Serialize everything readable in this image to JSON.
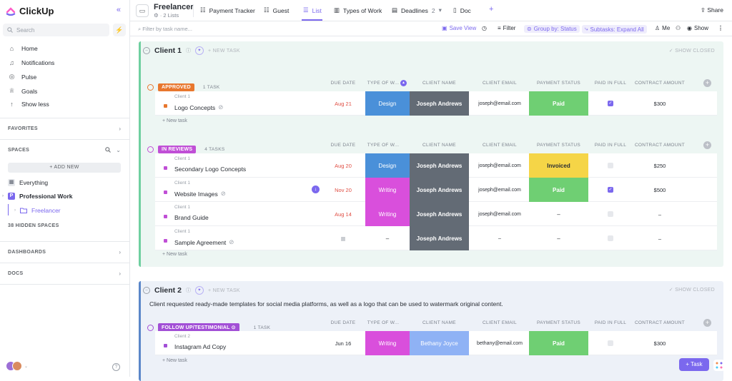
{
  "app": {
    "name": "ClickUp"
  },
  "sidebar": {
    "search_placeholder": "Search",
    "nav": [
      {
        "label": "Home",
        "icon": "home-icon"
      },
      {
        "label": "Notifications",
        "icon": "bell-icon"
      },
      {
        "label": "Pulse",
        "icon": "pulse-icon"
      },
      {
        "label": "Goals",
        "icon": "trophy-icon"
      },
      {
        "label": "Show less",
        "icon": "arrow-up-icon"
      }
    ],
    "favorites": "FAVORITES",
    "spaces": "SPACES",
    "add_new": "+ ADD NEW",
    "everything": "Everything",
    "space": "Professional Work",
    "space_initial": "P",
    "folder": "Freelancer",
    "hidden_spaces": "38 HIDDEN SPACES",
    "dashboards": "DASHBOARDS",
    "docs": "DOCS"
  },
  "header": {
    "title": "Freelancer",
    "subtitle": "· 2 Lists",
    "tabs": [
      "Payment Tracker",
      "Guest",
      "List",
      "Types of Work",
      "Deadlines",
      "Doc"
    ],
    "deadlines_count": "2",
    "share": "Share"
  },
  "toolbar": {
    "filter_placeholder": "Filter by task name...",
    "save_view": "Save View",
    "filter": "Filter",
    "group_by": "Group by: Status",
    "subtasks": "Subtasks: Expand All",
    "me": "Me",
    "show": "Show"
  },
  "columns": [
    "DUE DATE",
    "TYPE OF W...",
    "CLIENT NAME",
    "CLIENT EMAIL",
    "PAYMENT STATUS",
    "PAID IN FULL",
    "CONTRACT AMOUNT"
  ],
  "groups": [
    {
      "name": "Client 1",
      "new_task": "+ NEW TASK",
      "show_closed": "SHOW CLOSED",
      "statuses": [
        {
          "label": "APPROVED",
          "count": "1 TASK",
          "color": "#e8772e",
          "add_task": "+ New task",
          "tasks": [
            {
              "parent": "Client 1",
              "name": "Logo Concepts",
              "due": "Aug 21",
              "type": "Design",
              "type_color": "#4a90d9",
              "client": "Joseph Andrews",
              "client_color": "#636b75",
              "email": "joseph@email.com",
              "payment": "Paid",
              "pay_color": "#6fcf73",
              "pay_text": "#ffffff",
              "paid": true,
              "amount": "$300"
            }
          ]
        },
        {
          "label": "IN REVIEWS",
          "count": "4 TASKS",
          "color": "#c04fd6",
          "add_task": "+ New task",
          "tasks": [
            {
              "parent": "Client 1",
              "name": "Secondary Logo Concepts",
              "due": "Aug 20",
              "type": "Design",
              "type_color": "#4a90d9",
              "client": "Joseph Andrews",
              "client_color": "#636b75",
              "email": "joseph@email.com",
              "payment": "Invoiced",
              "pay_color": "#f5d547",
              "pay_text": "#292d34",
              "paid": false,
              "amount": "$250"
            },
            {
              "parent": "Client 1",
              "name": "Website Images",
              "due": "Nov 20",
              "type": "Writing",
              "type_color": "#d94fdc",
              "client": "Joseph Andrews",
              "client_color": "#636b75",
              "email": "joseph@email.com",
              "payment": "Paid",
              "pay_color": "#6fcf73",
              "pay_text": "#ffffff",
              "paid": true,
              "amount": "$500"
            },
            {
              "parent": "Client 1",
              "name": "Brand Guide",
              "due": "Aug 14",
              "type": "Writing",
              "type_color": "#d94fdc",
              "client": "Joseph Andrews",
              "client_color": "#636b75",
              "email": "joseph@email.com",
              "payment": "–",
              "pay_color": "#ffffff",
              "pay_text": "#292d34",
              "paid": false,
              "amount": "–"
            },
            {
              "parent": "Client 1",
              "name": "Sample Agreement",
              "due": "",
              "type": "–",
              "type_color": "#ffffff",
              "client": "Joseph Andrews",
              "client_color": "#636b75",
              "email": "–",
              "payment": "–",
              "pay_color": "#ffffff",
              "pay_text": "#292d34",
              "paid": false,
              "amount": "–"
            }
          ]
        }
      ]
    },
    {
      "name": "Client 2",
      "new_task": "+ NEW TASK",
      "show_closed": "SHOW CLOSED",
      "description": "Client requested ready-made templates for social media platforms, as well as a logo that can be used to watermark original content.",
      "statuses": [
        {
          "label": "FOLLOW UP/TESTIMONIAL",
          "count": "1 TASK",
          "color": "#a24fd6",
          "add_task": "+ New task",
          "tasks": [
            {
              "parent": "Client 2",
              "name": "Instagram Ad Copy",
              "due": "Jun 16",
              "type": "Writing",
              "type_color": "#d94fdc",
              "client": "Bethany Joyce",
              "client_color": "#8fb2f5",
              "email": "bethany@email.com",
              "payment": "Paid",
              "pay_color": "#6fcf73",
              "pay_text": "#ffffff",
              "paid": false,
              "amount": "$300"
            }
          ]
        }
      ]
    }
  ],
  "fab": "+ Task"
}
